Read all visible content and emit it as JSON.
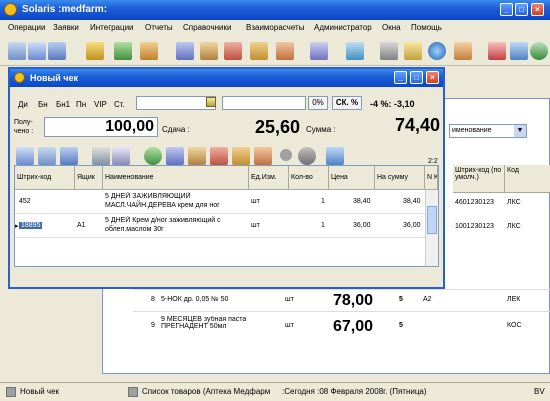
{
  "app": {
    "title": "Solaris :medfarm:",
    "menu": [
      "Операции",
      "Заявки",
      "Интеграции",
      "Отчеты",
      "Справочники",
      "Взаиморасчеты",
      "Администратор",
      "Окна",
      "Помощь"
    ]
  },
  "dialog": {
    "title": "Новый чек",
    "tabs": [
      "Ди",
      "Бн",
      "Бн1",
      "Пн",
      "VIP",
      "Ст."
    ],
    "percent_btn": "0%",
    "sk_btn": "СК. %",
    "discount_label": "-4 %: -3,10",
    "received_label": "Полу-\nчено :",
    "received_value": "100,00",
    "change_label": "Сдача :",
    "change_value": "25,60",
    "sum_label": "Сумма :",
    "sum_value": "74,40",
    "pager": "2:2",
    "columns": [
      "Штрих-код",
      "Ящик",
      "Наименование",
      "Ед.Изм.",
      "Кол-во",
      "Цена",
      "На сумму",
      "N K"
    ],
    "rows": [
      {
        "barcode": "452",
        "box": "",
        "name": "5 ДНЕЙ ЗАЖИВЛЯЮЩИЙ МАСЛ.ЧАЙН.ДЕРЕВА крем для ног",
        "unit": "шт",
        "qty": "1",
        "price": "38,40",
        "sum": "38,40"
      },
      {
        "barcode": "18895",
        "box": "A1",
        "name": "5 ДНЕЙ Крем д/ног заживляющий с облеп.маслом 30г",
        "unit": "шт",
        "qty": "1",
        "price": "36,00",
        "sum": "36,00"
      }
    ]
  },
  "background": {
    "sort_select": "именование",
    "columns": [
      "Штрих-код (по умолч.)",
      "Код"
    ],
    "right_rows": [
      {
        "barcode": "4601230123",
        "code": "ЛКС"
      },
      {
        "barcode": "1001230123",
        "code": "ЛКС"
      }
    ],
    "rows": [
      {
        "n": "8",
        "name": "5-НОК др. 0,05 № 50",
        "unit": "шт",
        "price": "78,00",
        "qty": "5",
        "box": "A2",
        "code": "ЛЕК"
      },
      {
        "n": "9",
        "name": "9 МЕСЯЦЕВ зубная паста ПРЕГНАДЕНТ 50мл",
        "unit": "шт",
        "price": "67,00",
        "qty": "5",
        "box": "",
        "code": "КОС"
      }
    ]
  },
  "status": {
    "item1": "Новый чек",
    "item2": "Список товаров  (Аптека Медфарм",
    "item3": ":Сегодня :08 Февраля 2008г. (Пятница)",
    "item4": "BV"
  }
}
